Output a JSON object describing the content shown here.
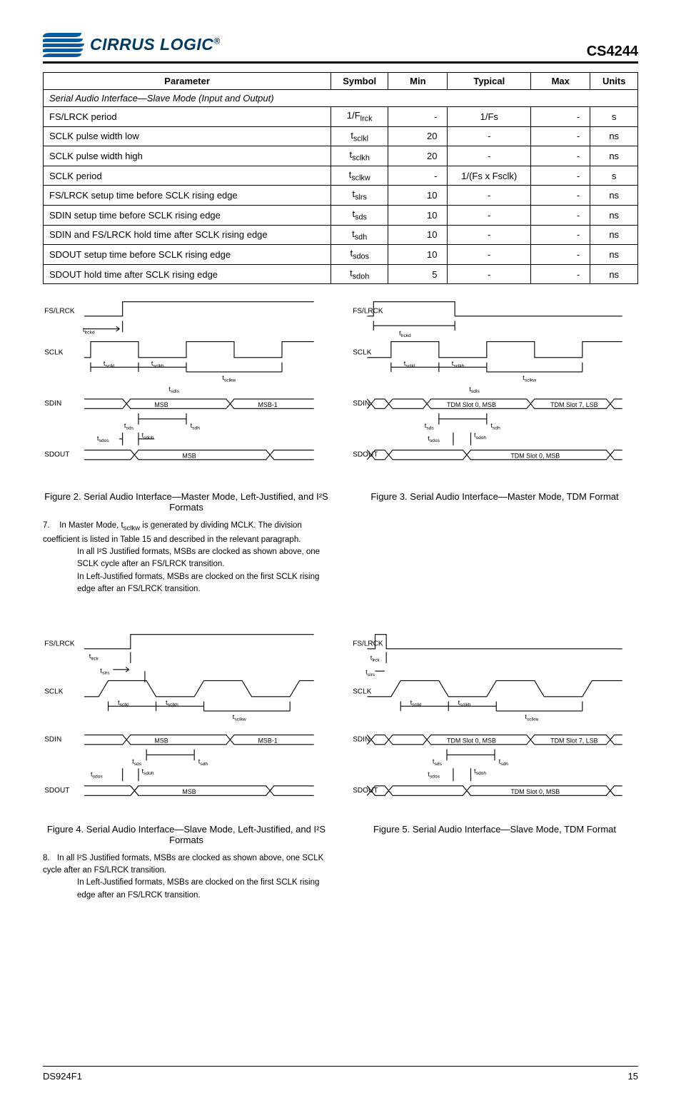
{
  "header": {
    "brand1": "CIRRUS LOGIC",
    "reg": "®",
    "product": "CS4244"
  },
  "table": {
    "head": [
      "Parameter",
      "Symbol",
      "Min",
      "Typical",
      "Max",
      "Units"
    ],
    "section": "Serial Audio Interface—Slave Mode (Input and Output)",
    "rows": [
      [
        "FS/LRCK period",
        "1/F",
        "-",
        "1/Fs",
        "-",
        "s"
      ],
      [
        "SCLK pulse width low",
        "t",
        "20",
        "-",
        "-",
        "ns"
      ],
      [
        "SCLK pulse width high",
        "t",
        "20",
        "-",
        "-",
        "ns"
      ],
      [
        "SCLK period",
        "t",
        "-",
        "1/(Fs x Fsclk)",
        "-",
        "s"
      ],
      [
        "FS/LRCK setup time before SCLK rising edge",
        "t",
        "10",
        "-",
        "-",
        "ns"
      ],
      [
        "SDIN setup time before SCLK rising edge",
        "t",
        "10",
        "-",
        "-",
        "ns"
      ],
      [
        "SDIN and FS/LRCK hold time after SCLK rising edge",
        "t",
        "10",
        "-",
        "-",
        "ns"
      ],
      [
        "SDOUT setup time before SCLK rising edge",
        "t",
        "10",
        "-",
        "-",
        "ns"
      ],
      [
        "SDOUT hold time after SCLK rising edge",
        "t",
        "5",
        "-",
        "-",
        "ns"
      ]
    ],
    "subs": [
      "lrck",
      "sclkl",
      "sclkh",
      "sclkw",
      "slrs",
      "sds",
      "sdh",
      "sdos",
      "sdoh"
    ]
  },
  "fig2": {
    "caption": "Figure 2. Serial Audio Interface—Master Mode, Left-Justified, and I²S Formats",
    "signals": [
      "FS/LRCK",
      "SCLK",
      "SDIN",
      "SDOUT"
    ],
    "timings": [
      "t",
      "t",
      "t",
      "t",
      "t",
      "t",
      "t",
      "t"
    ],
    "timing_subs": [
      "lrckd",
      "sclkl",
      "sclkh",
      "sclkw",
      "sdls",
      "sds",
      "sdh",
      "sdos",
      "sdoh"
    ],
    "msb": [
      "MSB",
      "MSB-1",
      "MSB",
      "MSB",
      "MSB-1",
      "MSB"
    ],
    "note_num": "7.",
    "note": "In Master Mode, t",
    "note_sub": "sclkw",
    "note_tail": " is generated by dividing MCLK. The division coefficient is listed in Table 15 and described in the relevant paragraph.",
    "note_line2": "In all I²S Justified formats, MSBs are clocked as shown above, one SCLK cycle after an FS/LRCK transition.",
    "note_line3": "In Left-Justified formats, MSBs are clocked on the first SCLK rising edge after an FS/LRCK transition."
  },
  "fig3": {
    "caption": "Figure 3. Serial Audio Interface—Master Mode, TDM Format",
    "signals": [
      "FS/LRCK",
      "SCLK",
      "SDIN",
      "SDOUT"
    ],
    "timings": [
      "t",
      "t",
      "t",
      "t",
      "t",
      "t",
      "t",
      "t"
    ],
    "timing_subs": [
      "lrckd",
      "sclkl",
      "sclkh",
      "sclkw",
      "sdls",
      "sds",
      "sdh",
      "sdos",
      "sdoh"
    ],
    "slots": [
      "TDM Slot 0, MSB",
      "TDM Slot 7, LSB",
      "TDM Slot 0, MSB",
      "TDM Slot 7, LSB"
    ]
  },
  "fig4": {
    "caption": "Figure 4. Serial Audio Interface—Slave Mode, Left-Justified, and I²S Formats",
    "signals": [
      "FS/LRCK",
      "SCLK",
      "SDIN",
      "SDOUT"
    ],
    "timings": [
      "t",
      "t",
      "t",
      "t",
      "t",
      "t",
      "t",
      "t",
      "t"
    ],
    "timing_subs": [
      "lrck",
      "slrs",
      "sclkl",
      "sclkh",
      "sclkw",
      "sds",
      "sdh",
      "sdos",
      "sdoh"
    ],
    "msb": [
      "MSB",
      "MSB-1",
      "MSB",
      "MSB",
      "MSB-1",
      "MSB"
    ],
    "note_num": "8.",
    "note": "In all I²S Justified formats, MSBs are clocked as shown above, one SCLK cycle after an FS/LRCK transition.",
    "note_line2": "In Left-Justified formats, MSBs are clocked on the first SCLK rising edge after an FS/LRCK transition."
  },
  "fig5": {
    "caption": "Figure 5. Serial Audio Interface—Slave Mode, TDM Format",
    "signals": [
      "FS/LRCK",
      "SCLK",
      "SDIN",
      "SDOUT"
    ],
    "timings": [
      "t",
      "t",
      "t",
      "t",
      "t",
      "t",
      "t",
      "t",
      "t"
    ],
    "timing_subs": [
      "lrck",
      "slrs",
      "sclkl",
      "sclkh",
      "sclkw",
      "sds",
      "sdh",
      "sdos",
      "sdoh"
    ],
    "slots": [
      "TDM Slot 0, MSB",
      "TDM Slot 7, LSB",
      "TDM Slot 0, MSB",
      "TDM Slot 7, LSB"
    ]
  },
  "footer": {
    "left": "DS924F1",
    "right": "15"
  }
}
